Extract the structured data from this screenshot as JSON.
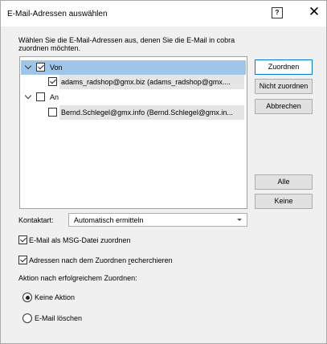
{
  "dialog": {
    "title": "E-Mail-Adressen auswählen",
    "help_glyph": "?",
    "close_glyph": "✕",
    "intro_text": "Wählen Sie die E-Mail-Adressen aus, denen Sie die E-Mail in cobra zuordnen möchten."
  },
  "tree": {
    "groups": [
      {
        "label": "Von",
        "expanded": true,
        "checked": true,
        "selected": true,
        "items": [
          {
            "label": "adams_radshop@gmx.biz (adams_radshop@gmx....",
            "checked": true
          }
        ]
      },
      {
        "label": "An",
        "expanded": true,
        "checked": false,
        "selected": false,
        "items": [
          {
            "label": "Bernd.Schlegel@gmx.info (Bernd.Schlegel@gmx.in...",
            "checked": false
          }
        ]
      }
    ]
  },
  "buttons": {
    "assign": "Zuordnen",
    "unassign": "Nicht zuordnen",
    "cancel": "Abbrechen",
    "all": "Alle",
    "none": "Keine"
  },
  "contact_type": {
    "label": "Kontaktart:",
    "value": "Automatisch ermitteln"
  },
  "options": {
    "msg_file": {
      "label_prefix": "E-Mail als MSG-Datei zuordnen",
      "checked": true
    },
    "research_prefix": "Adressen nach dem Zuordnen ",
    "research_underlined": "r",
    "research_suffix": "echerchieren",
    "research_checked": true
  },
  "after_action": {
    "label": "Aktion nach erfolgreichem Zuordnen:",
    "no_action": "Keine Aktion",
    "delete_mail": "E-Mail löschen",
    "selected": "no_action"
  },
  "colors": {
    "selection": "#9fc6e8",
    "primary_border": "#0078d7",
    "dialog_bg": "#f0f0f0"
  }
}
